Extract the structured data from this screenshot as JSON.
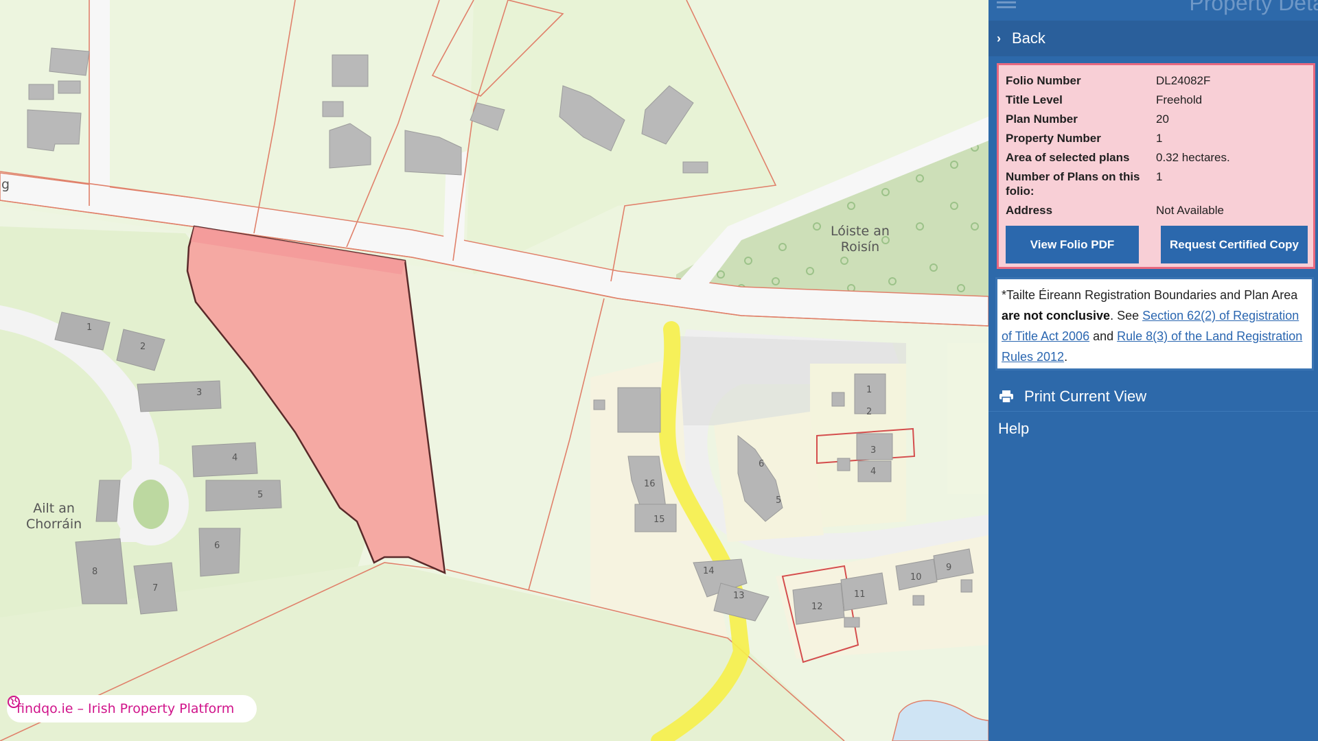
{
  "map": {
    "labels": {
      "loiste": "Lóiste an\nRoisín",
      "ailt": "Ailt an\nChorráin",
      "edge_fragment": "g"
    },
    "house_numbers_west": [
      "1",
      "2",
      "3",
      "4",
      "5",
      "6",
      "7",
      "8"
    ],
    "house_numbers_east": [
      "1",
      "2",
      "3",
      "4",
      "5",
      "6",
      "9",
      "10",
      "11",
      "12",
      "13",
      "14",
      "15",
      "16"
    ],
    "colors": {
      "selected_fill": "#f5a9a3",
      "selected_outline": "#5a2a2a",
      "boundary": "#e0806a",
      "road": "#f7f7f7",
      "grass": "#e3f0cf",
      "field": "#eef5e2",
      "yellow_path": "#f6f04a",
      "forest": "#cddfb8",
      "building": "#b5b5b5",
      "water": "#cfe4f4"
    },
    "watermark": "findqo.ie – Irish Property Platform"
  },
  "panel": {
    "title": "Property Details",
    "back_label": "Back",
    "details": [
      {
        "key": "Folio Number",
        "value": "DL24082F"
      },
      {
        "key": "Title Level",
        "value": "Freehold"
      },
      {
        "key": "Plan Number",
        "value": "20"
      },
      {
        "key": "Property Number",
        "value": "1"
      },
      {
        "key": "Area of selected plans",
        "value": "0.32 hectares."
      },
      {
        "key": "Number of Plans on this folio:",
        "value": "1"
      },
      {
        "key": "Address",
        "value": "Not Available"
      }
    ],
    "buttons": {
      "view_folio": "View Folio PDF",
      "request_copy": "Request Certified Copy"
    },
    "disclaimer": {
      "part1": "*Tailte Éireann Registration Boundaries and Plan Area ",
      "bold": "are not conclusive",
      "part2": ". See ",
      "link1": "Section 62(2) of Registration of Title Act 2006",
      "part3": " and ",
      "link2": "Rule 8(3) of the Land Registration Rules 2012",
      "part4": "."
    },
    "print_label": "Print Current View",
    "help_label": "Help",
    "accent": "#2d69aa"
  }
}
